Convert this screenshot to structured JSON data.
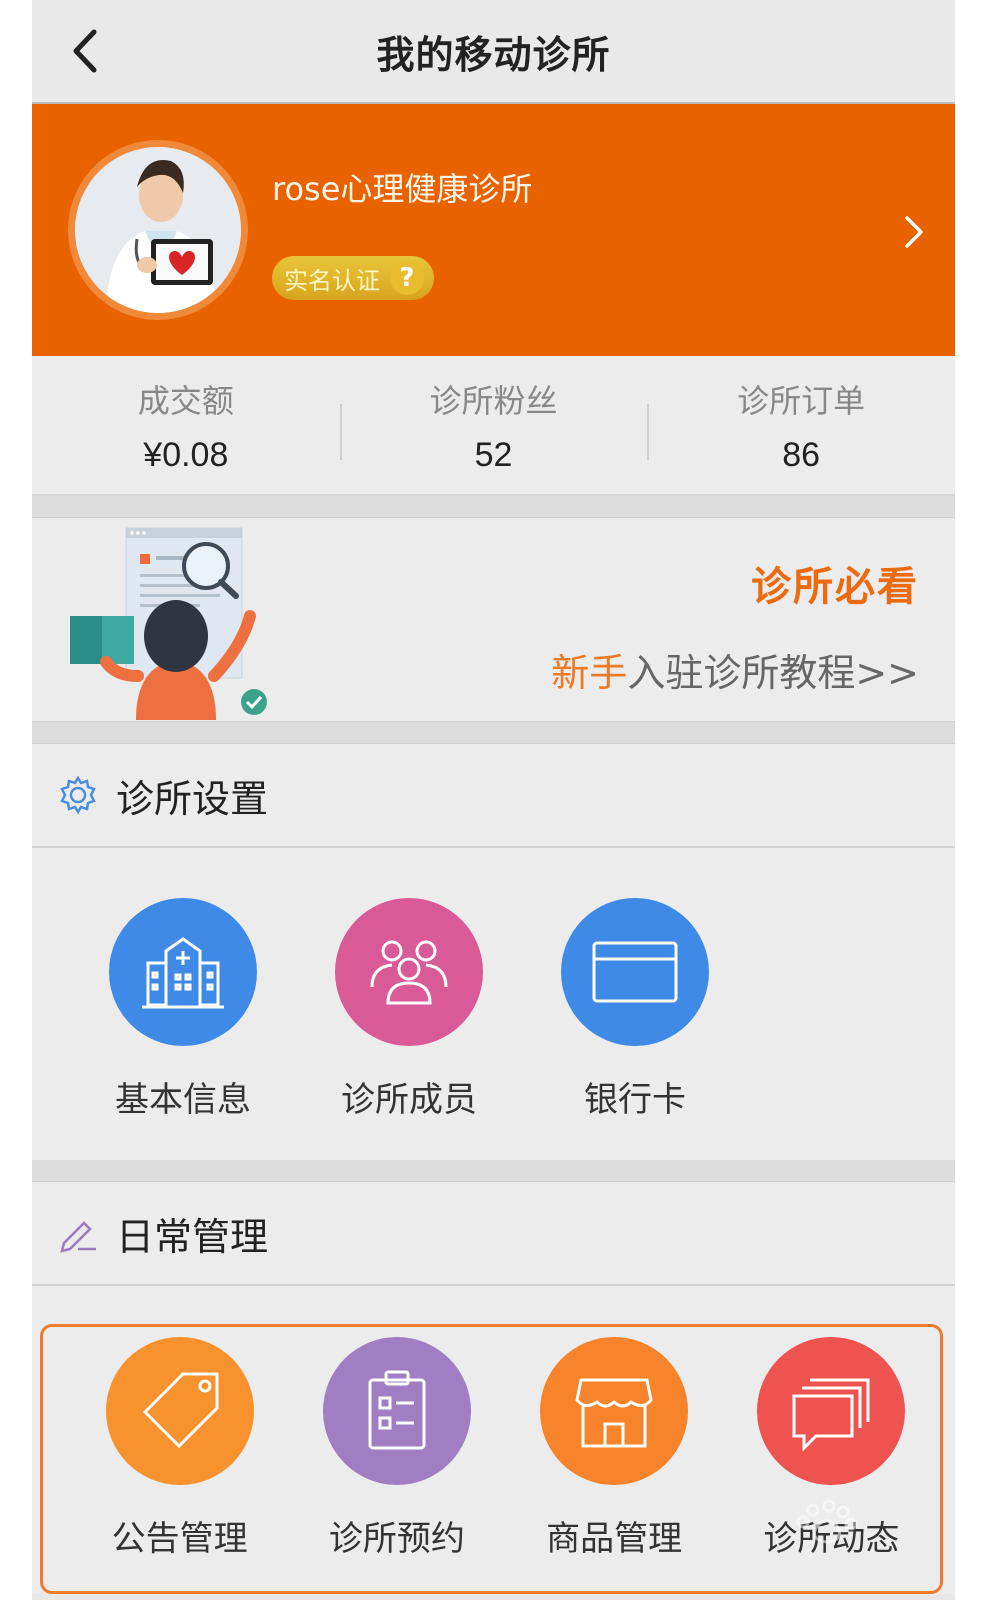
{
  "header": {
    "title": "我的移动诊所",
    "back_icon": "chevron-left-icon"
  },
  "profile": {
    "clinic_name": "rose心理健康诊所",
    "verify_label": "实名认证",
    "verify_help": "?",
    "arrow_icon": "chevron-right-icon"
  },
  "stats": [
    {
      "label": "成交额",
      "value": "¥0.08"
    },
    {
      "label": "诊所粉丝",
      "value": "52"
    },
    {
      "label": "诊所订单",
      "value": "86"
    }
  ],
  "banner": {
    "title": "诊所必看",
    "sub_highlight": "新手",
    "sub_rest": "入驻诊所教程>>"
  },
  "settings": {
    "title": "诊所设置",
    "icon": "gear-icon",
    "items": [
      {
        "label": "基本信息",
        "icon": "hospital-icon",
        "color": "#3e8ae6"
      },
      {
        "label": "诊所成员",
        "icon": "members-icon",
        "color": "#d85a97"
      },
      {
        "label": "银行卡",
        "icon": "bank-card-icon",
        "color": "#3e8ae6"
      }
    ]
  },
  "daily": {
    "title": "日常管理",
    "icon": "edit-icon",
    "items": [
      {
        "label": "公告管理",
        "icon": "tag-icon",
        "color": "#f7922e"
      },
      {
        "label": "诊所预约",
        "icon": "clipboard-icon",
        "color": "#a17ec3"
      },
      {
        "label": "商品管理",
        "icon": "store-icon",
        "color": "#f7832a"
      },
      {
        "label": "诊所动态",
        "icon": "chat-icon",
        "color": "#ef5350"
      }
    ]
  },
  "colors": {
    "brand_orange": "#e96200",
    "accent_orange": "#ec6a10"
  }
}
